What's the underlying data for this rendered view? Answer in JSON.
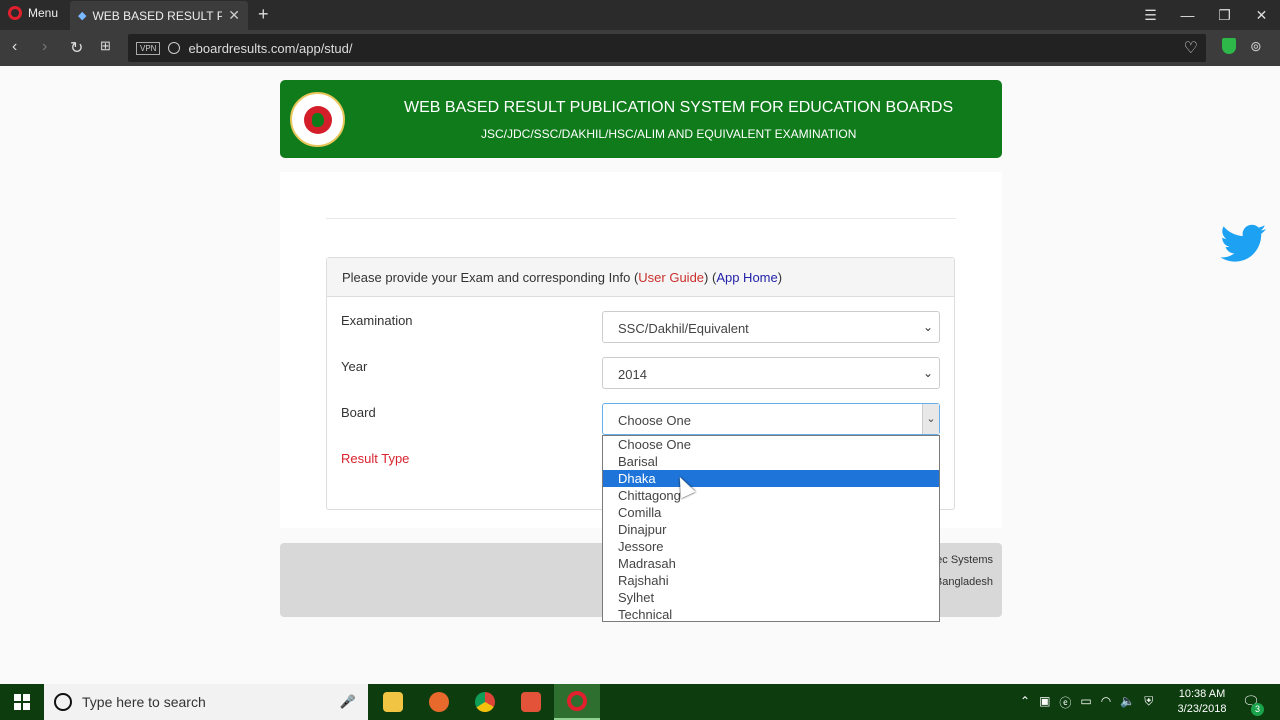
{
  "browser": {
    "menu_label": "Menu",
    "tab_title": "WEB BASED RESULT PUBLICATION",
    "url": "eboardresults.com/app/stud/",
    "vpn_label": "VPN"
  },
  "banner": {
    "title": "WEB BASED RESULT PUBLICATION SYSTEM FOR EDUCATION BOARDS",
    "subtitle": "JSC/JDC/SSC/DAKHIL/HSC/ALIM AND EQUIVALENT EXAMINATION"
  },
  "panel": {
    "intro": "Please provide your Exam and corresponding Info (",
    "user_guide": "User Guide",
    "mid": ") (",
    "app_home": "App Home",
    "end": ")"
  },
  "form": {
    "examination_label": "Examination",
    "examination_value": "SSC/Dakhil/Equivalent",
    "year_label": "Year",
    "year_value": "2014",
    "board_label": "Board",
    "board_value": "Choose One",
    "result_type_label": "Result Type"
  },
  "board_options": [
    "Choose One",
    "Barisal",
    "Dhaka",
    "Chittagong",
    "Comilla",
    "Dinajpur",
    "Jessore",
    "Madrasah",
    "Rajshahi",
    "Sylhet",
    "Technical"
  ],
  "highlighted_option": "Dhaka",
  "footer": {
    "line1": "tec Systems",
    "line2": "Bangladesh"
  },
  "taskbar": {
    "search_placeholder": "Type here to search",
    "time": "10:38 AM",
    "date": "3/23/2018",
    "notification_count": "3"
  },
  "colors": {
    "banner_green": "#0f7b1b",
    "link_red": "#c9302c",
    "link_blue": "#2222aa",
    "highlight_blue": "#1e74d8"
  }
}
